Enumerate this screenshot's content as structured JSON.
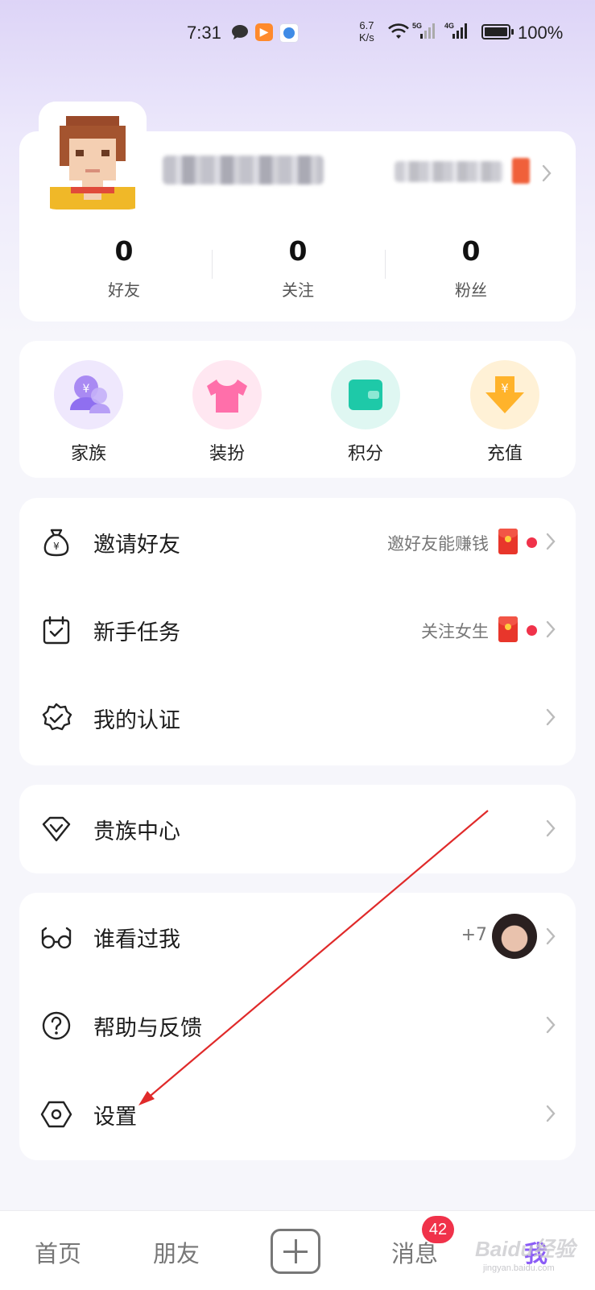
{
  "status_bar": {
    "time": "7:31",
    "speed_value": "6.7",
    "speed_unit": "K/s",
    "net1": "5G",
    "net2": "4G",
    "battery": "100%"
  },
  "profile": {
    "stats": [
      {
        "value": "0",
        "label": "好友"
      },
      {
        "value": "0",
        "label": "关注"
      },
      {
        "value": "0",
        "label": "粉丝"
      }
    ]
  },
  "quick_actions": [
    {
      "label": "家族",
      "icon": "family-icon",
      "color": "#a98af3",
      "bg": "#efe8fd"
    },
    {
      "label": "装扮",
      "icon": "tshirt-icon",
      "color": "#ff6faa",
      "bg": "#ffe7f1"
    },
    {
      "label": "积分",
      "icon": "wallet-icon",
      "color": "#1ec9a8",
      "bg": "#dff7f2"
    },
    {
      "label": "充值",
      "icon": "recharge-icon",
      "color": "#ffb32b",
      "bg": "#fff1d6"
    }
  ],
  "menu_group_1": [
    {
      "title": "邀请好友",
      "hint": "邀好友能赚钱",
      "icon": "money-bag-icon"
    },
    {
      "title": "新手任务",
      "hint": "关注女生",
      "icon": "calendar-check-icon"
    },
    {
      "title": "我的认证",
      "hint": "",
      "icon": "verified-badge-icon"
    }
  ],
  "menu_group_2": [
    {
      "title": "贵族中心",
      "icon": "diamond-icon"
    }
  ],
  "menu_group_3": [
    {
      "title": "谁看过我",
      "count": "+7",
      "icon": "glasses-icon"
    },
    {
      "title": "帮助与反馈",
      "icon": "help-icon"
    },
    {
      "title": "设置",
      "icon": "settings-icon"
    }
  ],
  "bottom_nav": {
    "home": "首页",
    "friends": "朋友",
    "messages": "消息",
    "messages_badge": "42",
    "me": "我"
  },
  "watermark": {
    "text": "Baidu经验",
    "sub": "jingyan.baidu.com"
  },
  "colors": {
    "accent": "#8b5cf6",
    "badge": "#f0324a",
    "annotation_arrow": "#e02a2a"
  }
}
